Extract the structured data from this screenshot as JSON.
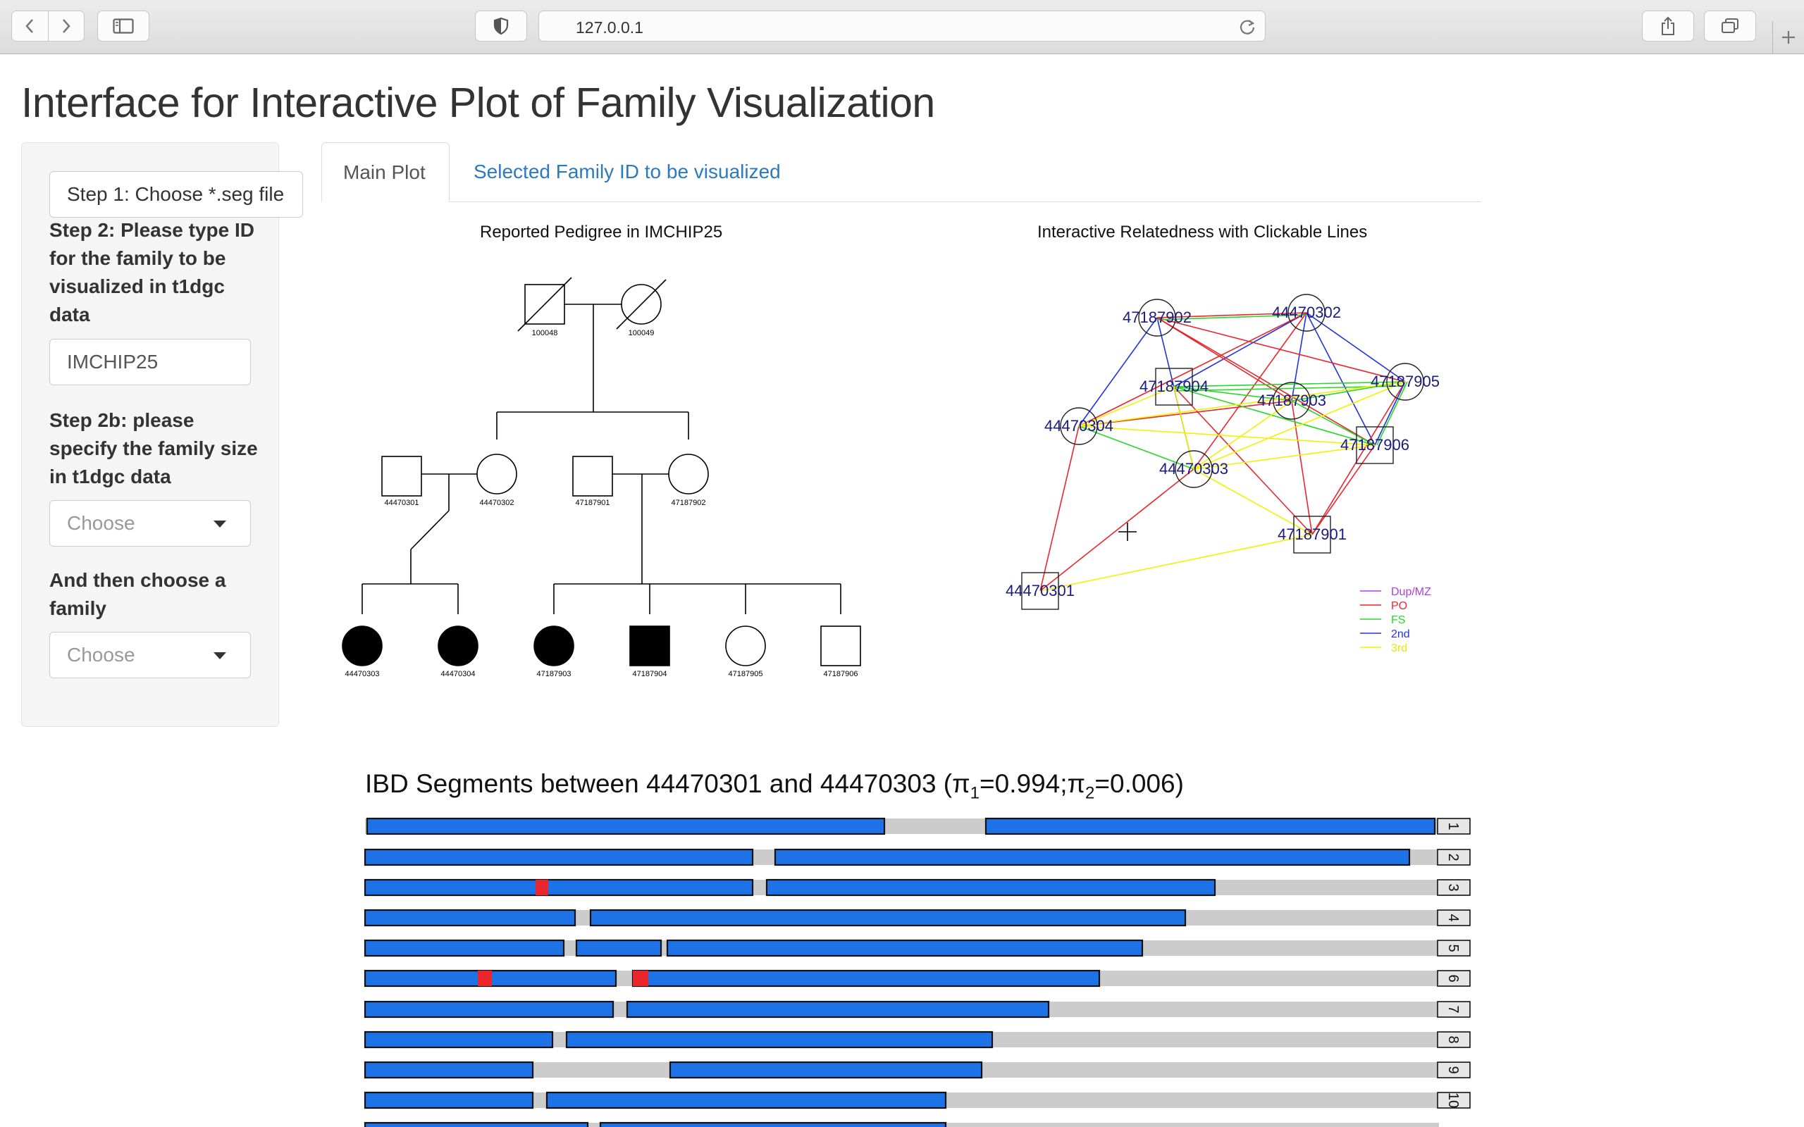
{
  "browser": {
    "url": "127.0.0.1"
  },
  "page": {
    "title": "Interface for Interactive Plot of Family Visualization"
  },
  "sidebar": {
    "file_button": "Step 1: Choose *.seg file",
    "step2_label": "Step 2: Please type ID for the family to be visualized in t1dgc data",
    "family_id_value": "IMCHIP25",
    "step2b_label": "Step 2b: please specify the family size in t1dgc data",
    "size_select": "Choose",
    "family_label": "And then choose a family",
    "family_select": "Choose"
  },
  "tabs": {
    "main": "Main Plot",
    "selected": "Selected Family ID to be visualized"
  },
  "pedigree": {
    "title": "Reported Pedigree in IMCHIP25",
    "ids": [
      "100048",
      "100049",
      "44470301",
      "44470302",
      "47187901",
      "47187902",
      "44470303",
      "44470304",
      "47187903",
      "47187904",
      "47187905",
      "47187906"
    ]
  },
  "network": {
    "title": "Interactive Relatedness with Clickable Lines",
    "nodes": [
      "47187902",
      "44470302",
      "47187904",
      "47187905",
      "47187903",
      "44470304",
      "47187906",
      "44470303",
      "47187901",
      "44470301"
    ],
    "legend": [
      {
        "label": "Dup/MZ",
        "color": "#b23ee0"
      },
      {
        "label": "PO",
        "color": "#e8262c"
      },
      {
        "label": "FS",
        "color": "#27d827"
      },
      {
        "label": "2nd",
        "color": "#2233dd"
      },
      {
        "label": "3rd",
        "color": "#f2f200"
      }
    ]
  },
  "ibd": {
    "title_prefix": "IBD Segments between 44470301 and 44470303 (",
    "pi1_symbol": "π",
    "pi1_sub": "1",
    "pi1_value": "=0.994;",
    "pi2_symbol": "π",
    "pi2_sub": "2",
    "pi2_value": "=0.006)",
    "chromosomes": [
      "1",
      "2",
      "3",
      "4",
      "5",
      "6",
      "7",
      "8",
      "9",
      "10"
    ]
  }
}
